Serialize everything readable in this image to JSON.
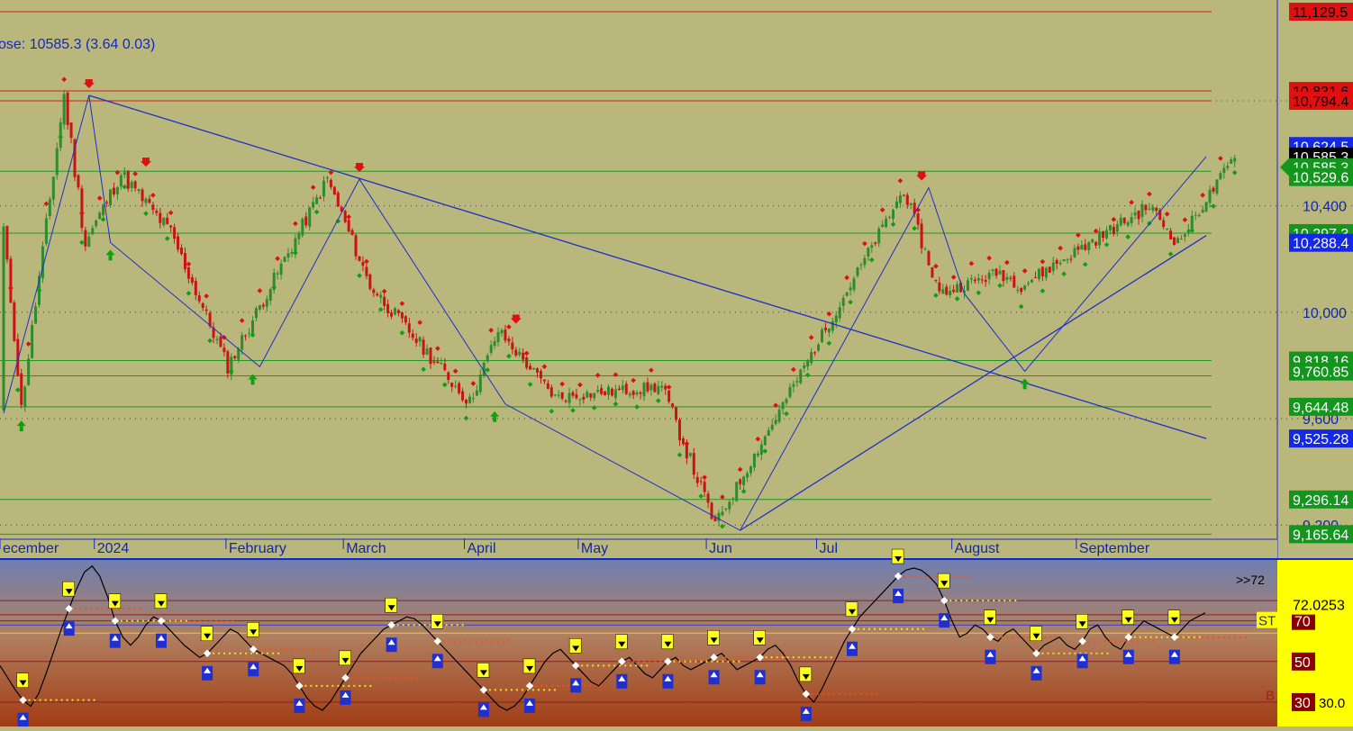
{
  "colors": {
    "panel_bg": "#b9b77b",
    "up_candle": "#2e8b2e",
    "down_candle": "#c81414",
    "trendline": "#1f2fc8",
    "support_line": "#1e9a1e",
    "resistance_line": "#d02010",
    "axis_bg": "#b9b77b",
    "osc_line": "#000000",
    "osc_bg_top": "#6f7fb0",
    "osc_bg_bottom": "#a23c14",
    "osc_axis_bg": "#ffff00"
  },
  "header": {
    "close_label": "ose: 10585.3 (3.64 0.03)"
  },
  "chart_data": {
    "type": "candlestick",
    "ylim": [
      9150,
      11160
    ],
    "grid_dotted": [
      10400,
      10000,
      9600,
      9200,
      10794.4
    ],
    "x_axis": {
      "labels": [
        "ecember",
        "2024",
        "February",
        "March",
        "April",
        "May",
        "Jun",
        "Jul",
        "August",
        "September"
      ]
    },
    "horizontal_lines": [
      {
        "value": 11129.5,
        "color": "#d02010"
      },
      {
        "value": 10831.6,
        "color": "#d02010"
      },
      {
        "value": 10794.4,
        "color": "#d02010"
      },
      {
        "value": 10529.6,
        "color": "#1e9a1e"
      },
      {
        "value": 10297.3,
        "color": "#1e9a1e"
      },
      {
        "value": 9818.16,
        "color": "#1e9a1e"
      },
      {
        "value": 9760.85,
        "color": "#1e9a1e"
      },
      {
        "value": 9644.48,
        "color": "#1e9a1e"
      },
      {
        "value": 9296.14,
        "color": "#1e9a1e"
      },
      {
        "value": 9165.64,
        "color": "#1e9a1e"
      }
    ],
    "price_labels": [
      {
        "text": "11,129.5",
        "value": 11129.5,
        "bg": "#e01010",
        "fg": "#000000"
      },
      {
        "text": "10,831.6",
        "value": 10831.6,
        "bg": "#e01010",
        "fg": "#000000"
      },
      {
        "text": "10,794.4",
        "value": 10794.4,
        "bg": "#e01010",
        "fg": "#000000"
      },
      {
        "text": "10,624.5",
        "value": 10624.5,
        "bg": "#1428e8",
        "fg": "#ffffff"
      },
      {
        "text": "10,585.3",
        "value": 10585.3,
        "bg": "#000000",
        "fg": "#ffffff"
      },
      {
        "text": "10,585.3",
        "value": 10545.0,
        "bg": "#14961e",
        "fg": "#ffffff"
      },
      {
        "text": "10,529.6",
        "value": 10508.0,
        "bg": "#14961e",
        "fg": "#ffffff"
      },
      {
        "text": "10,400",
        "value": 10400,
        "bg": "none",
        "fg": "#1428a0"
      },
      {
        "text": "10,297.3",
        "value": 10297.3,
        "bg": "#14961e",
        "fg": "#ffffff"
      },
      {
        "text": "10,288.4",
        "value": 10261.0,
        "bg": "#1428e8",
        "fg": "#ffffff"
      },
      {
        "text": "10,000",
        "value": 10000,
        "bg": "none",
        "fg": "#1428a0"
      },
      {
        "text": "9,818.16",
        "value": 9818.16,
        "bg": "#14961e",
        "fg": "#ffffff"
      },
      {
        "text": "9,760.85",
        "value": 9777.0,
        "bg": "#14961e",
        "fg": "#ffffff"
      },
      {
        "text": "9,600",
        "value": 9600,
        "bg": "none",
        "fg": "#1428a0"
      },
      {
        "text": "9,644.48",
        "value": 9644.48,
        "bg": "#14961e",
        "fg": "#ffffff"
      },
      {
        "text": "9,525.28",
        "value": 9525.28,
        "bg": "#1428e8",
        "fg": "#ffffff"
      },
      {
        "text": "9,296.14",
        "value": 9296.14,
        "bg": "#14961e",
        "fg": "#ffffff"
      },
      {
        "text": "9,200",
        "value": 9200,
        "bg": "none",
        "fg": "#1428a0"
      },
      {
        "text": "9,165.64",
        "value": 9165.64,
        "bg": "#14961e",
        "fg": "#ffffff"
      }
    ],
    "zigzag_pivots": [
      {
        "bar": 0,
        "value": 9620
      },
      {
        "bar": 24,
        "value": 10815
      },
      {
        "bar": 30,
        "value": 10262
      },
      {
        "bar": 72,
        "value": 9795
      },
      {
        "bar": 100,
        "value": 10500
      },
      {
        "bar": 141,
        "value": 9655
      },
      {
        "bar": 207,
        "value": 9180
      },
      {
        "bar": 260,
        "value": 10468
      },
      {
        "bar": 270,
        "value": 10070
      },
      {
        "bar": 287,
        "value": 9778
      },
      {
        "bar": 338,
        "value": 10585
      }
    ],
    "trendlines": [
      {
        "from": {
          "bar": 24,
          "value": 10815
        },
        "to": {
          "bar": 338,
          "value": 9525
        }
      },
      {
        "from": {
          "bar": 207,
          "value": 9180
        },
        "to": {
          "bar": 338,
          "value": 10288
        }
      }
    ],
    "peak_arrows": [
      {
        "bar": 24,
        "value": 10815
      },
      {
        "bar": 40,
        "value": 10520
      },
      {
        "bar": 100,
        "value": 10500
      },
      {
        "bar": 144,
        "value": 9930
      },
      {
        "bar": 258,
        "value": 10468
      }
    ],
    "trough_arrows": [
      {
        "bar": 5,
        "value": 9620
      },
      {
        "bar": 30,
        "value": 10262
      },
      {
        "bar": 70,
        "value": 9795
      },
      {
        "bar": 138,
        "value": 9655
      },
      {
        "bar": 207,
        "value": 9180
      },
      {
        "bar": 287,
        "value": 9778
      }
    ],
    "segments": [
      {
        "from": 0,
        "to": 10450,
        "bars": 6,
        "vol": 40
      },
      {
        "from": 10450,
        "to": 9640,
        "bars": 6,
        "vol": 45
      },
      {
        "from": 9640,
        "to": 10815,
        "bars": 12,
        "vol": 60
      },
      {
        "from": 10815,
        "to": 10262,
        "bars": 6,
        "vol": 80
      },
      {
        "from": 10262,
        "to": 10520,
        "bars": 10,
        "vol": 55
      },
      {
        "from": 10520,
        "to": 10300,
        "bars": 14,
        "vol": 60
      },
      {
        "from": 10300,
        "to": 9795,
        "bars": 16,
        "vol": 55
      },
      {
        "from": 9795,
        "to": 10500,
        "bars": 28,
        "vol": 55
      },
      {
        "from": 10500,
        "to": 10100,
        "bars": 12,
        "vol": 55
      },
      {
        "from": 10100,
        "to": 9660,
        "bars": 28,
        "vol": 55
      },
      {
        "from": 9660,
        "to": 9930,
        "bars": 8,
        "vol": 50
      },
      {
        "from": 9930,
        "to": 9680,
        "bars": 16,
        "vol": 45
      },
      {
        "from": 9680,
        "to": 9720,
        "bars": 30,
        "vol": 45
      },
      {
        "from": 9720,
        "to": 9200,
        "bars": 15,
        "vol": 60
      },
      {
        "from": 9200,
        "to": 10460,
        "bars": 53,
        "vol": 45
      },
      {
        "from": 10460,
        "to": 10070,
        "bars": 10,
        "vol": 55
      },
      {
        "from": 10070,
        "to": 10150,
        "bars": 17,
        "vol": 45
      },
      {
        "from": 10150,
        "to": 10100,
        "bars": 6,
        "vol": 50
      },
      {
        "from": 10100,
        "to": 10400,
        "bars": 36,
        "vol": 50
      },
      {
        "from": 10400,
        "to": 10260,
        "bars": 8,
        "vol": 50
      },
      {
        "from": 10260,
        "to": 10585,
        "bars": 16,
        "vol": 45
      }
    ],
    "oscillator": {
      "levels": [
        {
          "text": "70",
          "value": 70
        },
        {
          "text": "50",
          "value": 50
        },
        {
          "text": "30",
          "value": 30
        }
      ],
      "current_label": "72.0253",
      "marker_label": ">>72",
      "tag_label": "ST",
      "extra_label": "30.0",
      "b_label": "B",
      "ylim": [
        18,
        100
      ],
      "values": [
        48,
        42,
        36,
        31,
        28,
        34,
        44,
        55,
        66,
        76,
        86,
        94,
        97,
        92,
        82,
        70,
        62,
        58,
        62,
        68,
        72,
        70,
        66,
        62,
        58,
        55,
        52,
        54,
        58,
        62,
        66,
        64,
        60,
        56,
        54,
        52,
        50,
        48,
        44,
        38,
        32,
        28,
        26,
        30,
        36,
        42,
        48,
        54,
        58,
        62,
        66,
        68,
        70,
        72,
        71,
        68,
        64,
        60,
        56,
        52,
        48,
        44,
        40,
        36,
        32,
        28,
        26,
        28,
        32,
        38,
        44,
        50,
        54,
        56,
        52,
        48,
        44,
        40,
        38,
        42,
        46,
        50,
        52,
        48,
        44,
        42,
        46,
        50,
        52,
        48,
        46,
        48,
        50,
        52,
        54,
        50,
        46,
        48,
        50,
        52,
        56,
        58,
        54,
        48,
        40,
        34,
        30,
        36,
        44,
        52,
        60,
        66,
        72,
        76,
        80,
        84,
        88,
        92,
        95,
        96,
        95,
        92,
        88,
        80,
        70,
        62,
        64,
        68,
        66,
        62,
        60,
        64,
        66,
        62,
        58,
        54,
        58,
        60,
        62,
        58,
        56,
        60,
        66,
        68,
        62,
        58,
        56,
        62,
        66,
        70,
        68,
        66,
        64,
        62,
        66,
        70,
        72,
        74
      ]
    }
  }
}
